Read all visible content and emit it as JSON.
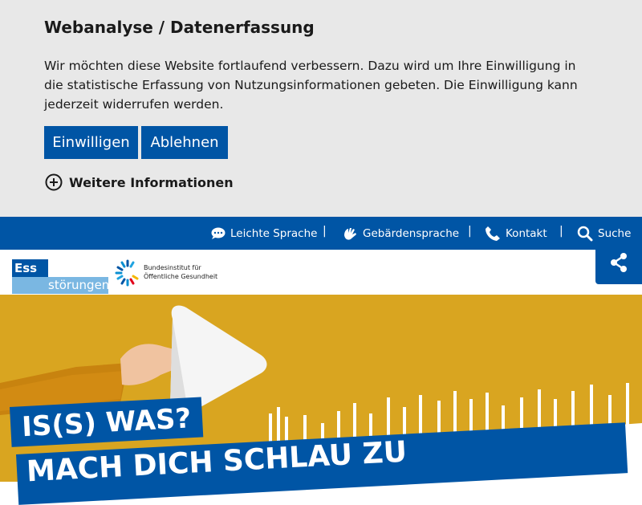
{
  "consent": {
    "title": "Webanalyse / Datenerfassung",
    "text": "Wir möchten diese Website fortlaufend verbessern. Dazu wird um Ihre Einwilligung in die statistische Erfassung von Nutzungsinformationen gebeten. Die Einwilligung kann jederzeit widerrufen werden.",
    "accept_label": "Einwilligen",
    "decline_label": "Ablehnen",
    "more_info_label": "Weitere Informationen"
  },
  "topnav": {
    "items": [
      {
        "label": "Leichte Sprache",
        "icon": "speech-bubble-icon"
      },
      {
        "label": "Gebärdensprache",
        "icon": "sign-language-icon"
      },
      {
        "label": "Kontakt",
        "icon": "phone-icon"
      },
      {
        "label": "Suche",
        "icon": "search-icon"
      }
    ],
    "separator": "|"
  },
  "header": {
    "logo_part1": "Ess",
    "logo_part2": "störungen",
    "partner_line1": "Bundesinstitut für",
    "partner_line2": "Öffentliche Gesundheit",
    "share_icon": "share-icon"
  },
  "hero": {
    "headline1": "IS(S) WAS?",
    "headline2": "MACH DICH SCHLAU ZU"
  },
  "colors": {
    "primary": "#0055a5",
    "banner_bg": "#e8e8e8",
    "hero_yellow": "#d9a520",
    "logo_light": "#7ab7e2"
  }
}
